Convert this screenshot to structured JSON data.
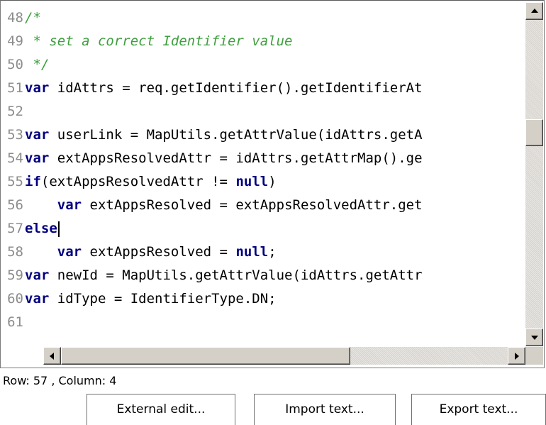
{
  "editor": {
    "lines": [
      {
        "num": "48",
        "segments": [
          {
            "t": "/*",
            "c": "cm"
          }
        ]
      },
      {
        "num": "49",
        "segments": [
          {
            "t": " * set a correct Identifier value",
            "c": "cm"
          }
        ]
      },
      {
        "num": "50",
        "segments": [
          {
            "t": " */",
            "c": "cm"
          }
        ]
      },
      {
        "num": "51",
        "segments": [
          {
            "t": "var",
            "c": "kw"
          },
          {
            "t": " idAttrs = req.getIdentifier().getIdentifierAt",
            "c": ""
          }
        ]
      },
      {
        "num": "52",
        "segments": []
      },
      {
        "num": "53",
        "segments": [
          {
            "t": "var",
            "c": "kw"
          },
          {
            "t": " userLink = MapUtils.getAttrValue(idAttrs.getA",
            "c": ""
          }
        ]
      },
      {
        "num": "54",
        "segments": [
          {
            "t": "var",
            "c": "kw"
          },
          {
            "t": " extAppsResolvedAttr = idAttrs.getAttrMap().ge",
            "c": ""
          }
        ]
      },
      {
        "num": "55",
        "segments": [
          {
            "t": "if",
            "c": "kw"
          },
          {
            "t": "(extAppsResolvedAttr != ",
            "c": ""
          },
          {
            "t": "null",
            "c": "kw"
          },
          {
            "t": ")",
            "c": ""
          }
        ]
      },
      {
        "num": "56",
        "segments": [
          {
            "t": "    ",
            "c": ""
          },
          {
            "t": "var",
            "c": "kw"
          },
          {
            "t": " extAppsResolved = extAppsResolvedAttr.get",
            "c": ""
          }
        ]
      },
      {
        "num": "57",
        "segments": [
          {
            "t": "else",
            "c": "kw"
          }
        ],
        "caret": true
      },
      {
        "num": "58",
        "segments": [
          {
            "t": "    ",
            "c": ""
          },
          {
            "t": "var",
            "c": "kw"
          },
          {
            "t": " extAppsResolved = ",
            "c": ""
          },
          {
            "t": "null",
            "c": "kw"
          },
          {
            "t": ";",
            "c": ""
          }
        ]
      },
      {
        "num": "59",
        "segments": [
          {
            "t": "var",
            "c": "kw"
          },
          {
            "t": " newId = MapUtils.getAttrValue(idAttrs.getAttr",
            "c": ""
          }
        ]
      },
      {
        "num": "60",
        "segments": [
          {
            "t": "var",
            "c": "kw"
          },
          {
            "t": " idType = IdentifierType.DN;",
            "c": ""
          }
        ]
      },
      {
        "num": "61",
        "segments": []
      }
    ]
  },
  "status": {
    "row_col": "Row: 57 , Column: 4"
  },
  "buttons": {
    "external_edit": "External edit...",
    "import_text": "Import text...",
    "export_text": "Export text..."
  },
  "icons": {
    "scroll_up": "scroll-up-arrow-icon",
    "scroll_down": "scroll-down-arrow-icon",
    "scroll_left": "scroll-left-arrow-icon",
    "scroll_right": "scroll-right-arrow-icon"
  }
}
